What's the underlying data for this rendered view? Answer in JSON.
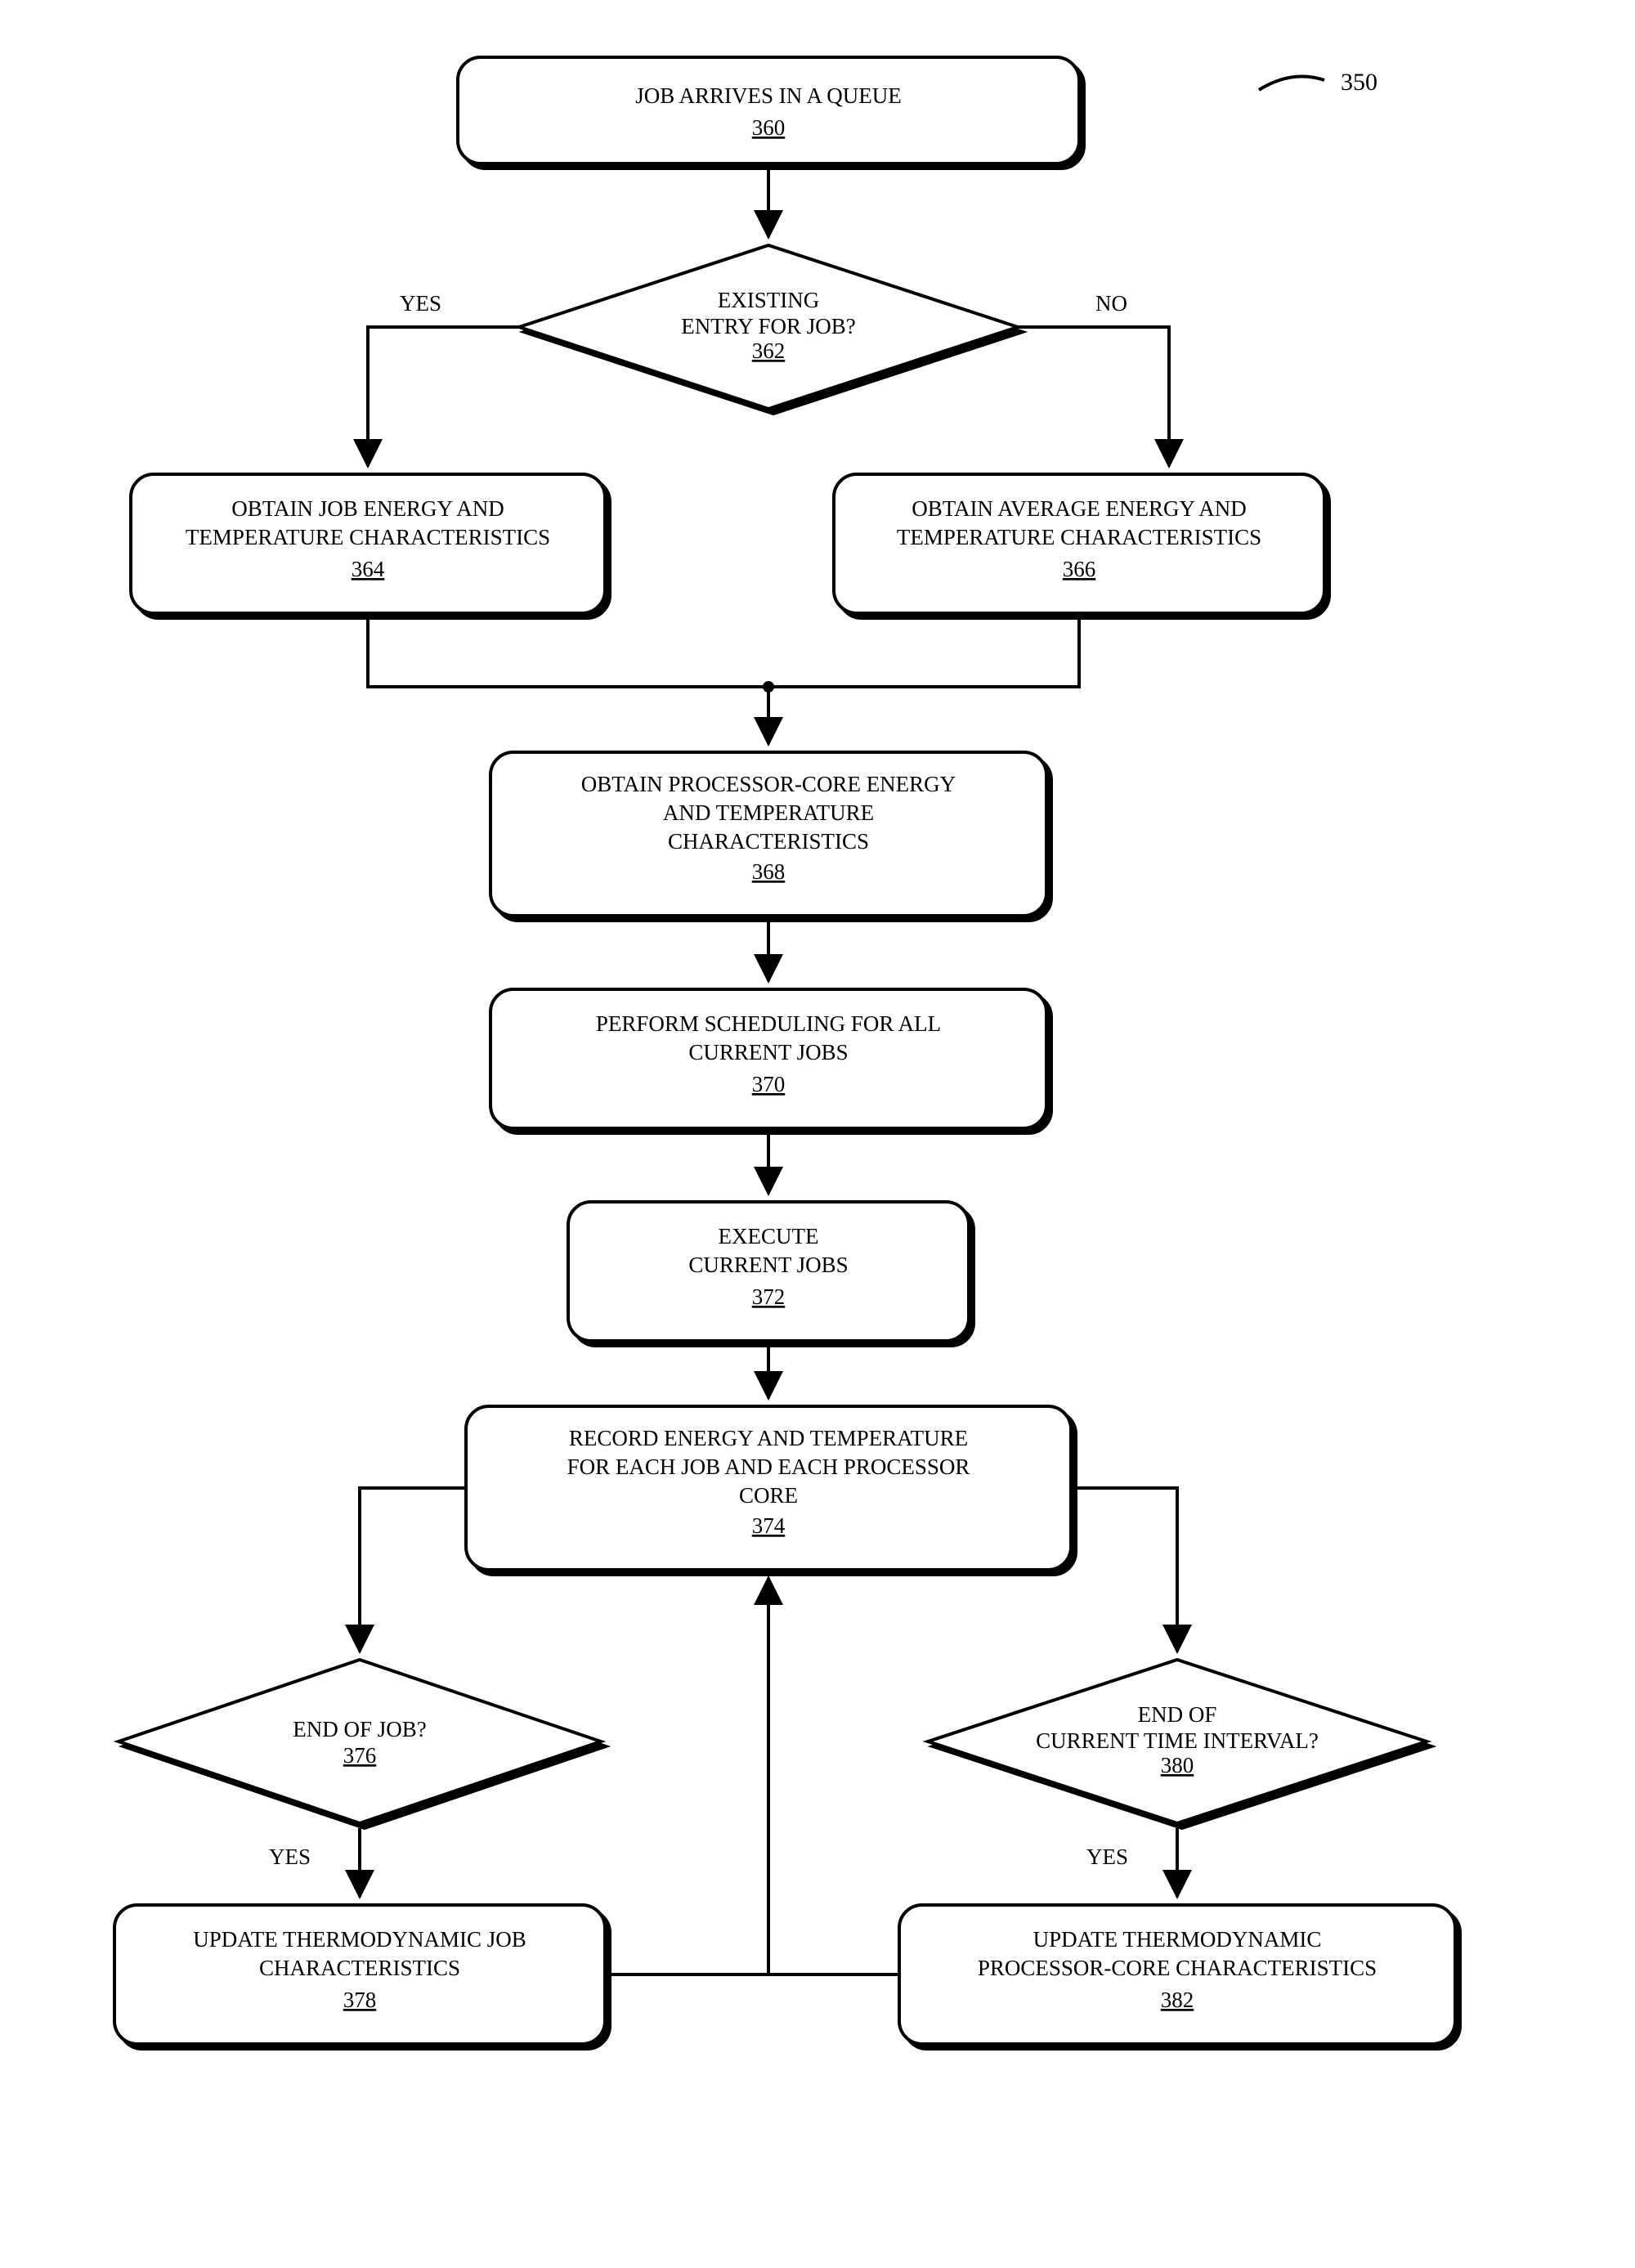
{
  "figure_ref": "350",
  "nodes": {
    "n360": {
      "lines": [
        "JOB ARRIVES IN A QUEUE"
      ],
      "ref": "360"
    },
    "n362": {
      "lines": [
        "EXISTING",
        "ENTRY FOR JOB?"
      ],
      "ref": "362"
    },
    "n364": {
      "lines": [
        "OBTAIN JOB ENERGY AND",
        "TEMPERATURE CHARACTERISTICS"
      ],
      "ref": "364"
    },
    "n366": {
      "lines": [
        "OBTAIN AVERAGE ENERGY AND",
        "TEMPERATURE CHARACTERISTICS"
      ],
      "ref": "366"
    },
    "n368": {
      "lines": [
        "OBTAIN PROCESSOR-CORE ENERGY",
        "AND TEMPERATURE",
        "CHARACTERISTICS"
      ],
      "ref": "368"
    },
    "n370": {
      "lines": [
        "PERFORM SCHEDULING FOR ALL",
        "CURRENT JOBS"
      ],
      "ref": "370"
    },
    "n372": {
      "lines": [
        "EXECUTE",
        "CURRENT JOBS"
      ],
      "ref": "372"
    },
    "n374": {
      "lines": [
        "RECORD ENERGY AND TEMPERATURE",
        "FOR EACH JOB AND EACH PROCESSOR",
        "CORE"
      ],
      "ref": "374"
    },
    "n376": {
      "lines": [
        "END OF JOB?"
      ],
      "ref": "376"
    },
    "n378": {
      "lines": [
        "UPDATE THERMODYNAMIC JOB",
        "CHARACTERISTICS"
      ],
      "ref": "378"
    },
    "n380": {
      "lines": [
        "END OF",
        "CURRENT TIME INTERVAL?"
      ],
      "ref": "380"
    },
    "n382": {
      "lines": [
        "UPDATE THERMODYNAMIC",
        "PROCESSOR-CORE CHARACTERISTICS"
      ],
      "ref": "382"
    }
  },
  "edge_labels": {
    "yes_362": "YES",
    "no_362": "NO",
    "yes_376": "YES",
    "yes_380": "YES"
  }
}
